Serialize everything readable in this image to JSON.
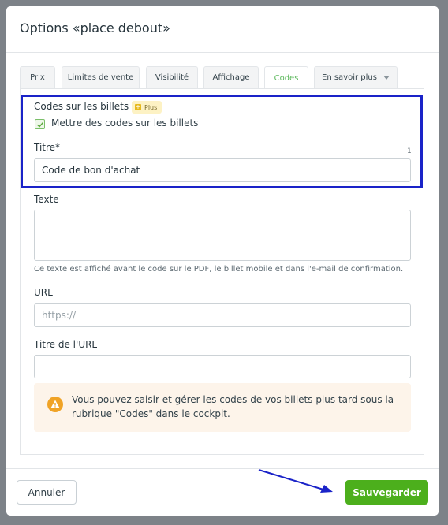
{
  "dialog": {
    "title": "Options «place debout»"
  },
  "tabs": [
    {
      "label": "Prix"
    },
    {
      "label": "Limites de vente"
    },
    {
      "label": "Visibilité"
    },
    {
      "label": "Affichage"
    },
    {
      "label": "Codes"
    },
    {
      "label": "En savoir plus"
    }
  ],
  "codes_section": {
    "heading": "Codes sur les billets",
    "badge": "Plus",
    "checkbox_label": "Mettre des codes sur les billets",
    "checkbox_checked": true
  },
  "fields": {
    "title_label": "Titre*",
    "title_counter": "1",
    "title_value": "Code de bon d'achat",
    "text_label": "Texte",
    "text_help": "Ce texte est affiché avant le code sur le PDF, le billet mobile et dans l'e-mail de confirmation.",
    "url_label": "URL",
    "url_placeholder": "https://",
    "url_title_label": "Titre de l'URL"
  },
  "notice": {
    "icon": "warning-icon",
    "text": "Vous pouvez saisir et gérer les codes de vos billets plus tard sous la rubrique \"Codes\" dans le cockpit."
  },
  "footer": {
    "cancel_label": "Annuler",
    "save_label": "Sauvegarder"
  },
  "colors": {
    "accent_green": "#4caf1c",
    "highlight_blue": "#1a23c8",
    "notice_bg": "#fdf4ea",
    "warning_orange": "#f0a326"
  }
}
